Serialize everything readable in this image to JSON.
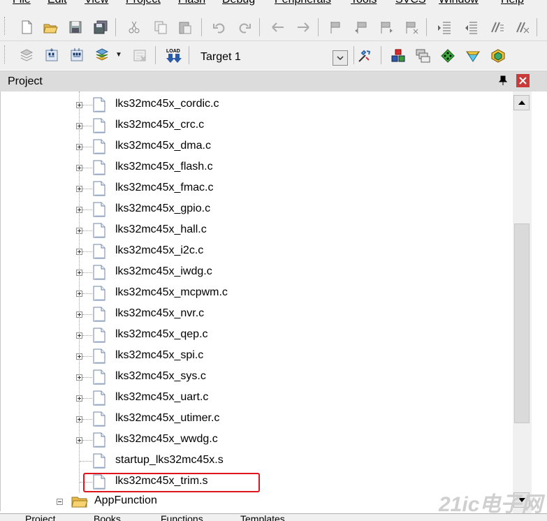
{
  "menu": [
    "File",
    "Edit",
    "View",
    "Project",
    "Flash",
    "Debug",
    "Peripherals",
    "Tools",
    "SVCS",
    "Window",
    "Help"
  ],
  "toolbar1_icons": [
    "new-file-icon",
    "open-folder-icon",
    "save-icon",
    "save-all-icon",
    "cut-icon",
    "copy-icon",
    "paste-icon",
    "undo-icon",
    "redo-icon",
    "nav-back-icon",
    "nav-forward-icon",
    "bookmark-icon",
    "bookmark-prev-icon",
    "bookmark-next-icon",
    "bookmark-clear-icon",
    "indent-icon",
    "unindent-icon",
    "comment-icon",
    "uncomment-icon"
  ],
  "toolbar2_icons": [
    "translate-icon",
    "build-icon",
    "rebuild-icon",
    "batch-build-icon",
    "stop-build-icon",
    "download-icon",
    "target-options-icon",
    "manage-components-icon",
    "file-extensions-icon",
    "select-packs-icon",
    "pack-installer-icon",
    "rte-icon"
  ],
  "target": {
    "label": "Target 1"
  },
  "panel": {
    "title": "Project",
    "pin": "\u0004",
    "close": "x"
  },
  "tree": {
    "files": [
      "lks32mc45x_cordic.c",
      "lks32mc45x_crc.c",
      "lks32mc45x_dma.c",
      "lks32mc45x_flash.c",
      "lks32mc45x_fmac.c",
      "lks32mc45x_gpio.c",
      "lks32mc45x_hall.c",
      "lks32mc45x_i2c.c",
      "lks32mc45x_iwdg.c",
      "lks32mc45x_mcpwm.c",
      "lks32mc45x_nvr.c",
      "lks32mc45x_qep.c",
      "lks32mc45x_spi.c",
      "lks32mc45x_sys.c",
      "lks32mc45x_uart.c",
      "lks32mc45x_utimer.c",
      "lks32mc45x_wwdg.c",
      "startup_lks32mc45x.s",
      "lks32mc45x_trim.s"
    ],
    "expandable_count": 17,
    "highlighted_index": 18,
    "folder": "AppFunction"
  },
  "bottom_tabs": [
    "Project",
    "Books",
    "Functions",
    "Templates"
  ],
  "watermark": "21ic电子网",
  "colors": {
    "highlight": "#e0141c",
    "chrome": "#f0f0f0",
    "panel_header": "#dcdcdc"
  }
}
